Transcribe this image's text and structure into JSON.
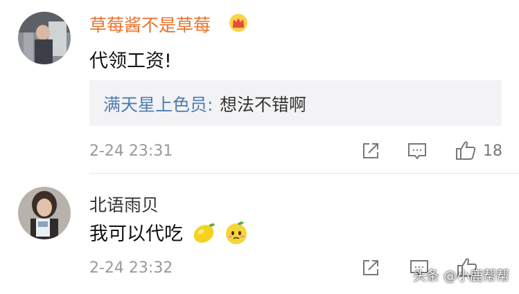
{
  "comments": [
    {
      "username": "草莓酱不是草莓",
      "badge_icon": "crown-icon",
      "content": "代领工资!",
      "reply": {
        "user": "满天星上色员:",
        "text": "想法不错啊"
      },
      "time": "2-24 23:31",
      "likes": "18"
    },
    {
      "username": "北语雨贝",
      "content": "我可以代吃",
      "emojis": [
        "lemon-icon",
        "sad-lemon-icon"
      ],
      "time": "2-24 23:32"
    }
  ],
  "watermark": "头条 @小鹿帮帮",
  "colors": {
    "vip_name": "#e8722c",
    "reply_user": "#4d7cb0",
    "time": "#999999",
    "reply_bg": "#f3f3f5"
  }
}
